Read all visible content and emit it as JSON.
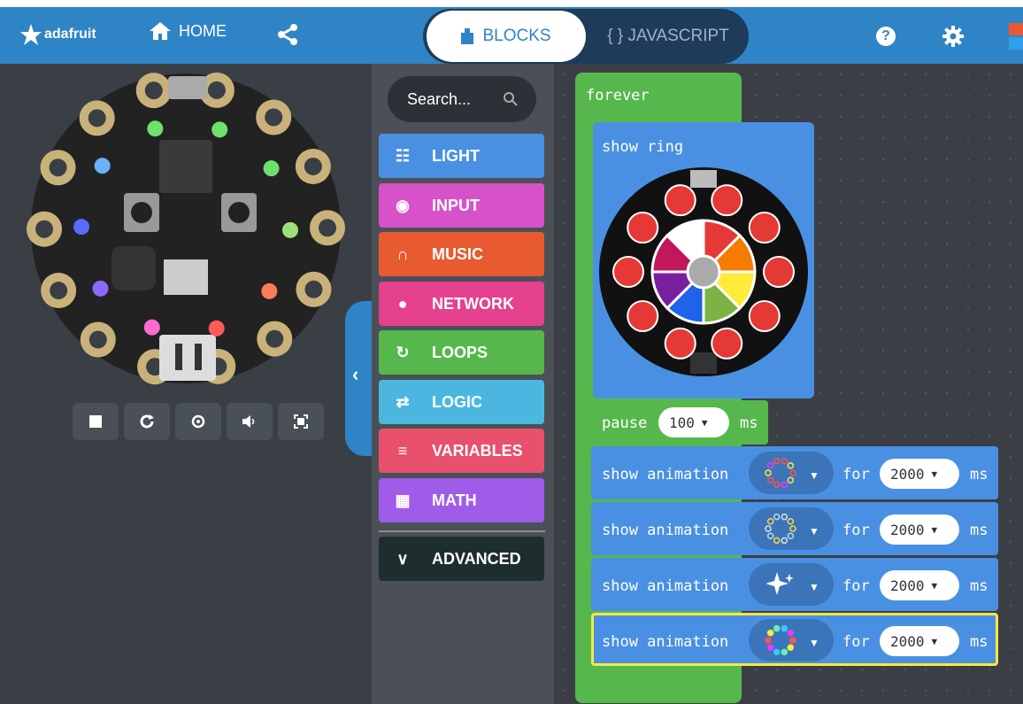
{
  "header": {
    "logo_text": "adafruit",
    "home_label": "HOME",
    "tab_blocks": "BLOCKS",
    "tab_javascript": "{ } JAVASCRIPT",
    "help_symbol": "?",
    "brand_color": "#2f84c6"
  },
  "simulator": {
    "buttons": [
      "stop-icon",
      "restart-icon",
      "debug-icon",
      "sound-icon",
      "fullscreen-icon"
    ]
  },
  "toolbox": {
    "search_placeholder": "Search...",
    "categories": [
      {
        "label": "LIGHT",
        "color": "#4a90e2",
        "icon": "grid-icon"
      },
      {
        "label": "INPUT",
        "color": "#d752c9",
        "icon": "target-icon"
      },
      {
        "label": "MUSIC",
        "color": "#e85b30",
        "icon": "headphones-icon"
      },
      {
        "label": "NETWORK",
        "color": "#e5418f",
        "icon": "chat-icon"
      },
      {
        "label": "LOOPS",
        "color": "#56b84c",
        "icon": "loop-icon"
      },
      {
        "label": "LOGIC",
        "color": "#4bb7e0",
        "icon": "shuffle-icon"
      },
      {
        "label": "VARIABLES",
        "color": "#e8506b",
        "icon": "list-icon"
      },
      {
        "label": "MATH",
        "color": "#9f5ce8",
        "icon": "calculator-icon"
      }
    ],
    "advanced_label": "ADVANCED"
  },
  "workspace": {
    "forever_label": "forever",
    "show_ring_label": "show ring",
    "pause_label": "pause",
    "pause_value": "100",
    "ms_label": "ms",
    "show_animation_label": "show animation",
    "for_label": "for",
    "animations": [
      {
        "duration": "2000"
      },
      {
        "duration": "2000"
      },
      {
        "duration": "2000"
      },
      {
        "duration": "2000"
      }
    ]
  }
}
